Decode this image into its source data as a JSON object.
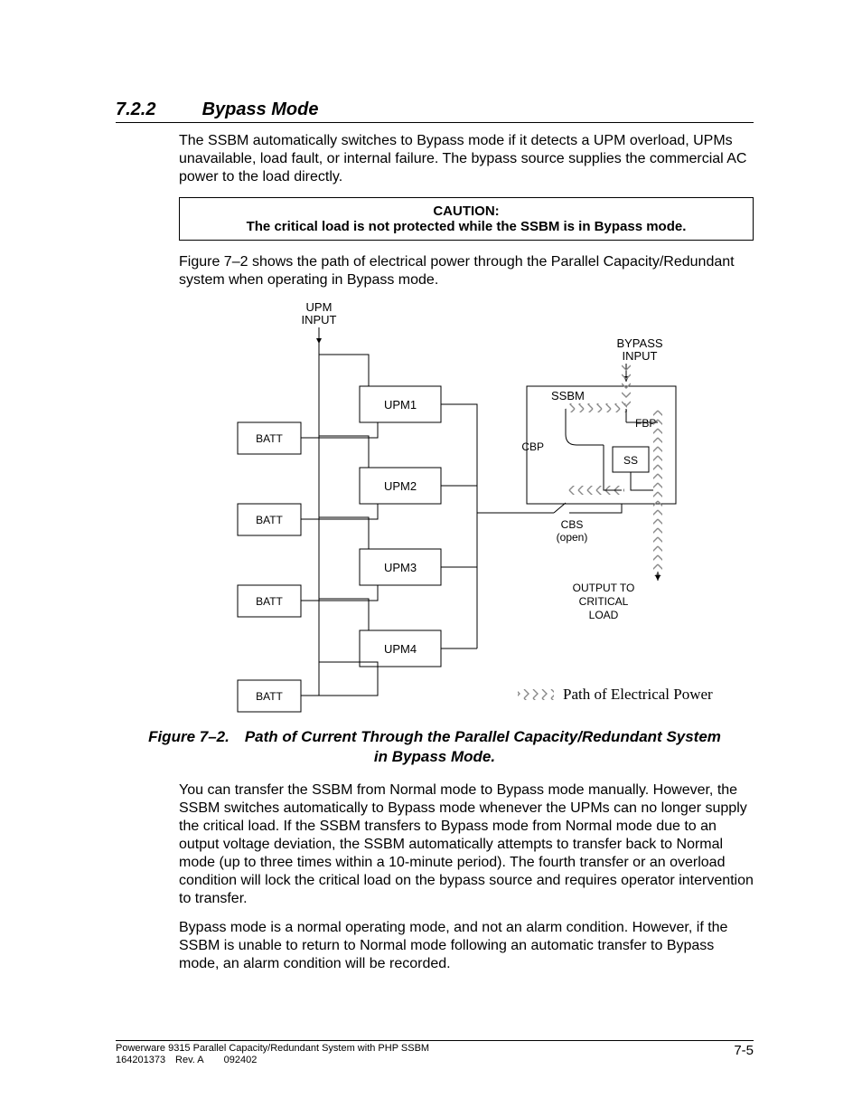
{
  "heading": {
    "number": "7.2.2",
    "title": "Bypass Mode"
  },
  "p1": "The SSBM automatically switches to Bypass mode if it detects a UPM overload, UPMs unavailable, load fault, or internal failure.  The bypass source supplies the commercial AC power to the load directly.",
  "caution": {
    "label": "CAUTION:",
    "text": "The critical load is not protected while the SSBM is in Bypass mode."
  },
  "p2": "Figure 7–2 shows the path of electrical power through the Parallel Capacity/Redundant system when operating in Bypass mode.",
  "diagram": {
    "labels": {
      "upm_input_line1": "UPM",
      "upm_input_line2": "INPUT",
      "bypass_input_line1": "BYPASS",
      "bypass_input_line2": "INPUT",
      "upm": [
        "UPM1",
        "UPM2",
        "UPM3",
        "UPM4"
      ],
      "batt": "BATT",
      "ssbm": "SSBM",
      "fbp": "FBP",
      "cbp": "CBP",
      "ss": "SS",
      "cbs": "CBS",
      "cbs_state": "(open)",
      "output_line1": "OUTPUT TO",
      "output_line2": "CRITICAL",
      "output_line3": "LOAD",
      "legend": "Path of Electrical Power"
    }
  },
  "fig_caption_line1": "Figure 7–2. Path of Current Through the Parallel Capacity/Redundant System",
  "fig_caption_line2": "in Bypass Mode.",
  "p3": "You can transfer the SSBM from Normal mode to Bypass mode manually.  However, the SSBM switches automatically to Bypass mode whenever the UPMs can no longer supply the critical load.  If the SSBM transfers to Bypass mode from Normal mode due to an output voltage deviation, the SSBM automatically attempts to transfer back to Normal mode (up to three times within a 10-minute period). The fourth transfer or an overload condition will lock the critical load on the bypass source and requires operator intervention to transfer.",
  "p4": "Bypass mode is a normal operating mode, and not an alarm condition.  However, if the SSBM is unable to return to Normal mode following an automatic transfer to Bypass mode, an alarm condition will be recorded.",
  "footer": {
    "line1": "Powerware 9315 Parallel Capacity/Redundant System with PHP SSBM",
    "line2": "164201373 Rev. A  092402",
    "page": "7-5"
  }
}
